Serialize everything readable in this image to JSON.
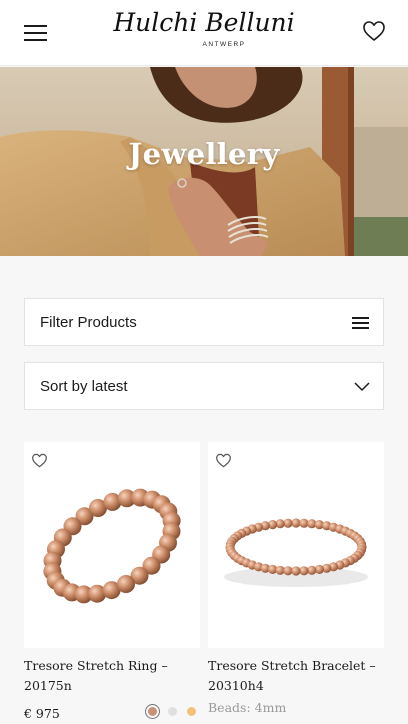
{
  "header": {
    "brand_script": "Hulchi Belluni",
    "brand_sub": "ANTWERP",
    "menu_icon": "hamburger-menu-icon",
    "wishlist_icon": "heart-icon"
  },
  "hero": {
    "title": "Jewellery"
  },
  "filter": {
    "label": "Filter Products",
    "icon": "filter-lines-icon"
  },
  "sort": {
    "label": "Sort by latest",
    "icon": "chevron-down-icon"
  },
  "products": [
    {
      "title": "Tresore Stretch Ring – 20175n",
      "price": "€ 975",
      "swatch_colors": [
        "#c9927a",
        "#e0e0e0",
        "#f2c27a"
      ]
    },
    {
      "title": "Tresore Stretch Bracelet – 20310h4",
      "beads": "Beads: 4mm"
    }
  ],
  "colors": {
    "page_bg": "#f7f7f7",
    "rose_gold": "#c98e69",
    "text": "#1b1b1b"
  }
}
